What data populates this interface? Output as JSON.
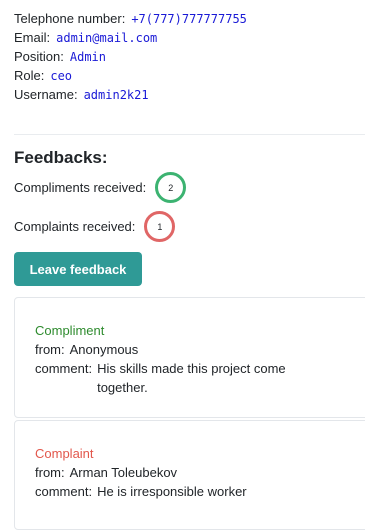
{
  "profile": {
    "telephone_label": "Telephone number:",
    "telephone_value": "+7(777)777777755",
    "email_label": "Email:",
    "email_value": "admin@mail.com",
    "position_label": "Position:",
    "position_value": "Admin",
    "role_label": "Role:",
    "role_value": "ceo",
    "username_label": "Username:",
    "username_value": "admin2k21"
  },
  "feedbacks": {
    "title": "Feedbacks:",
    "compliments_label": "Compliments received:",
    "compliments_count": "2",
    "complaints_label": "Complaints received:",
    "complaints_count": "1",
    "leave_button": "Leave feedback",
    "items": [
      {
        "type": "Compliment",
        "from_label": "from:",
        "from": "Anonymous",
        "comment_label": "comment:",
        "comment": "His skills made this project come together."
      },
      {
        "type": "Complaint",
        "from_label": "from:",
        "from": "Arman Toleubekov",
        "comment_label": "comment:",
        "comment": "He is irresponsible worker"
      }
    ]
  },
  "colors": {
    "compliment": "#2e8b2e",
    "complaint": "#e2574c",
    "button": "#2f9a96",
    "value_text": "#1a1ad6"
  }
}
